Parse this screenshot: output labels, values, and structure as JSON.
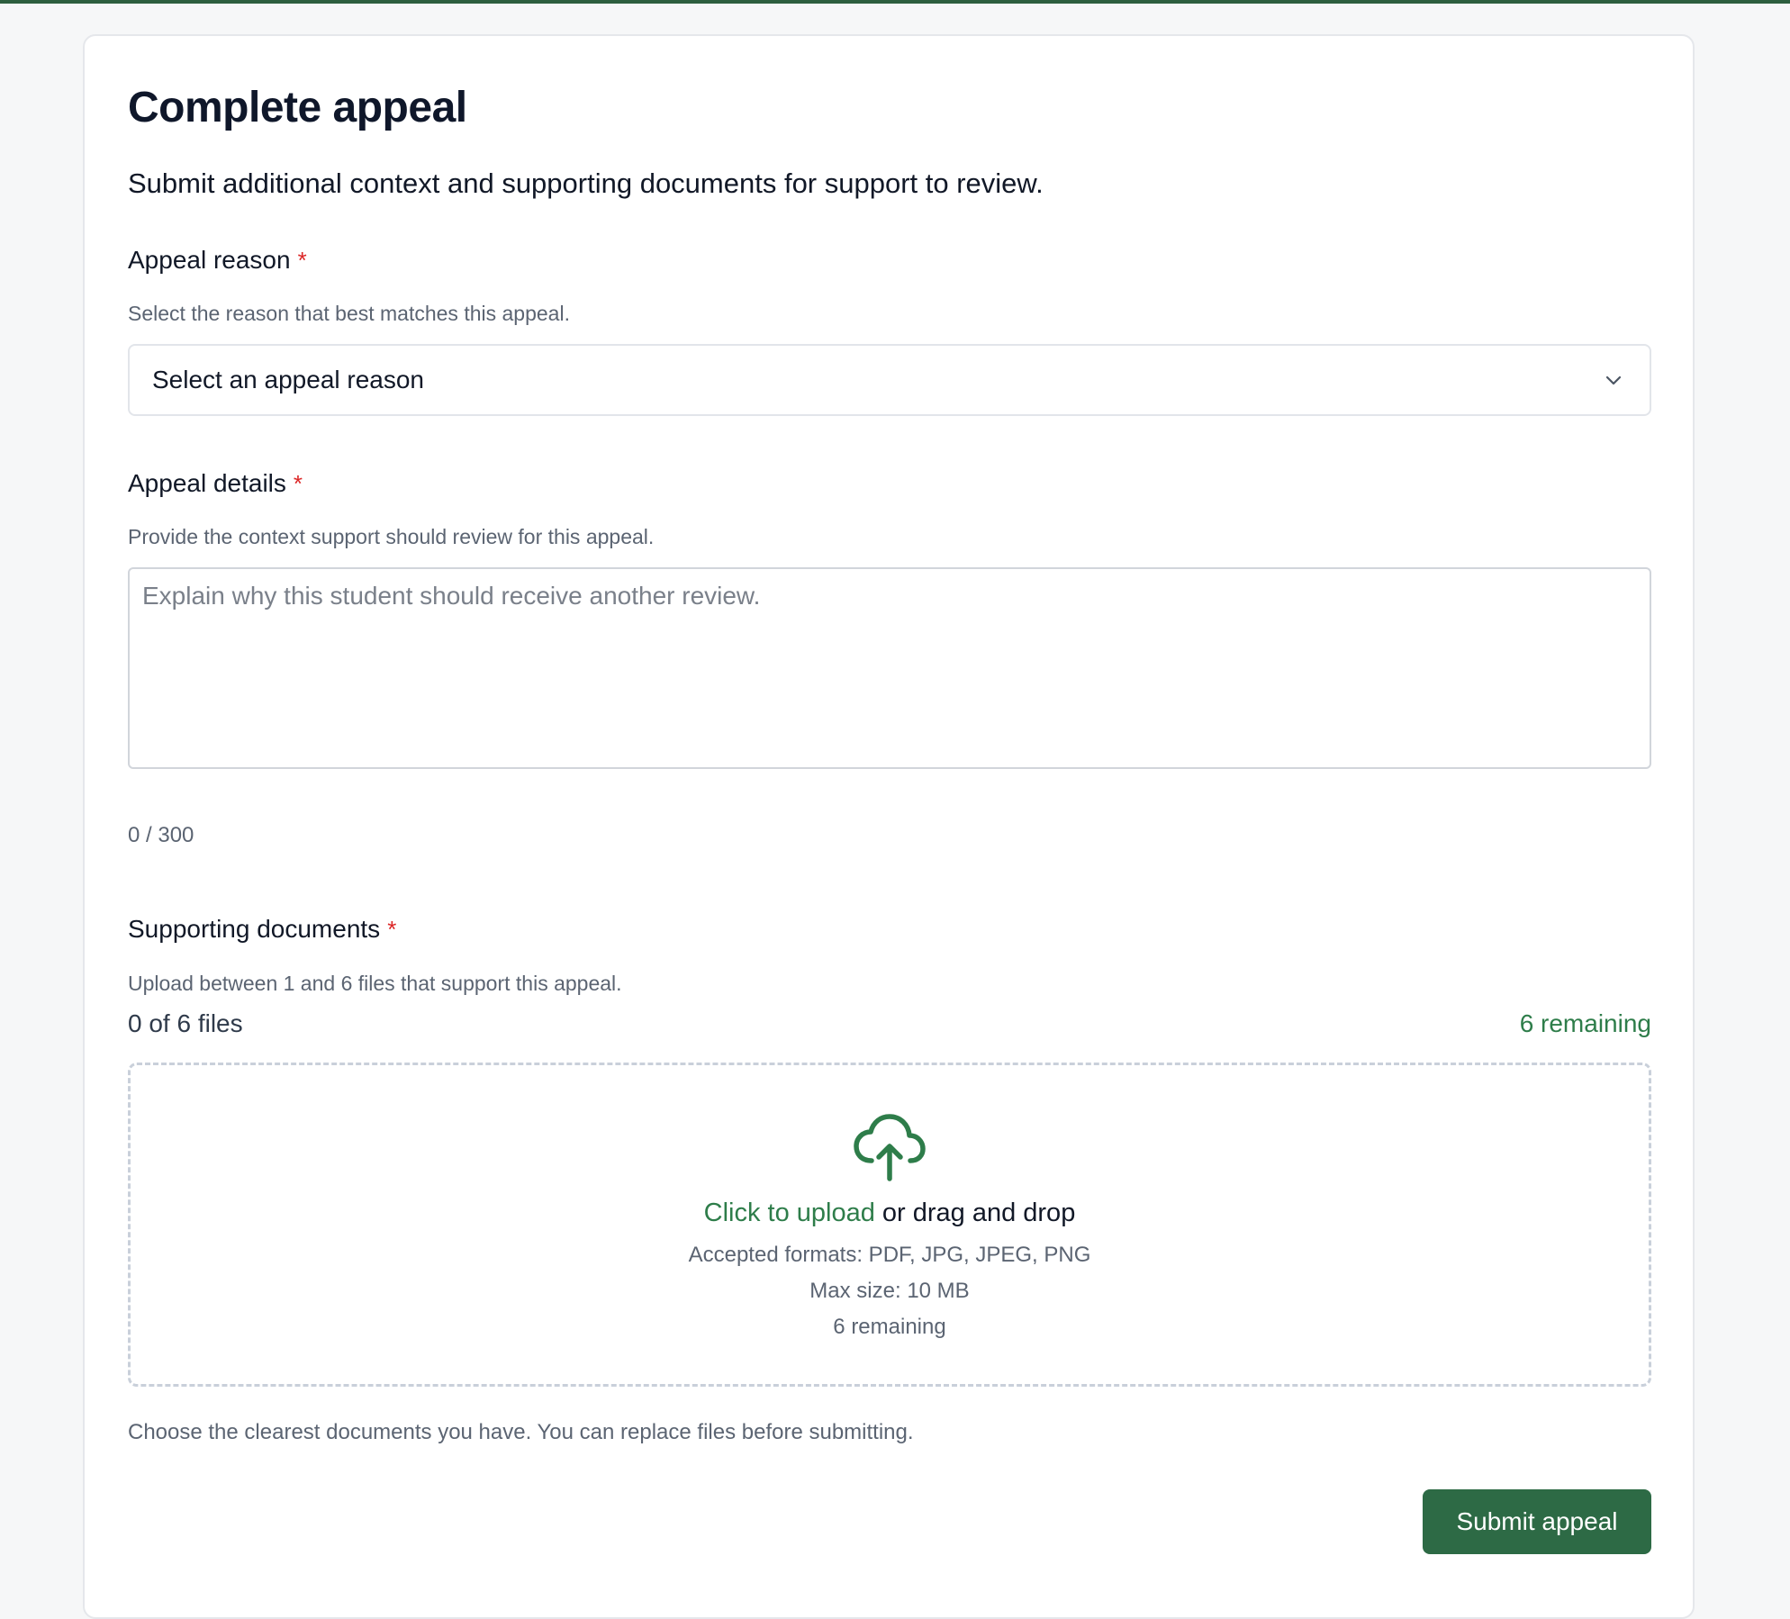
{
  "page": {
    "title": "Complete appeal",
    "subtitle": "Submit additional context and supporting documents for support to review."
  },
  "required_marker": "*",
  "colors": {
    "brand": "#2d6a45",
    "accent_text": "#2e7d4a",
    "required": "#dc2626",
    "top_bar": "#2d5f3f"
  },
  "appeal_reason": {
    "label": "Appeal reason",
    "help": "Select the reason that best matches this appeal.",
    "selected_value": "Select an appeal reason",
    "icon": "chevron-down-icon"
  },
  "appeal_details": {
    "label": "Appeal details",
    "help": "Provide the context support should review for this appeal.",
    "value": "",
    "placeholder": "Explain why this student should receive another review.",
    "char_count": "0 / 300"
  },
  "supporting_documents": {
    "label": "Supporting documents",
    "help": "Upload between 1 and 6 files that support this appeal.",
    "files_count": "0 of 6 files",
    "remaining": "6 remaining",
    "dropzone": {
      "icon": "cloud-upload-icon",
      "link_text": "Click to upload",
      "rest_text": "or drag and drop",
      "formats": "Accepted formats: PDF, JPG, JPEG, PNG",
      "max_size": "Max size: 10 MB",
      "remaining": "6 remaining"
    },
    "footnote": "Choose the clearest documents you have. You can replace files before submitting."
  },
  "actions": {
    "submit_label": "Submit appeal"
  }
}
